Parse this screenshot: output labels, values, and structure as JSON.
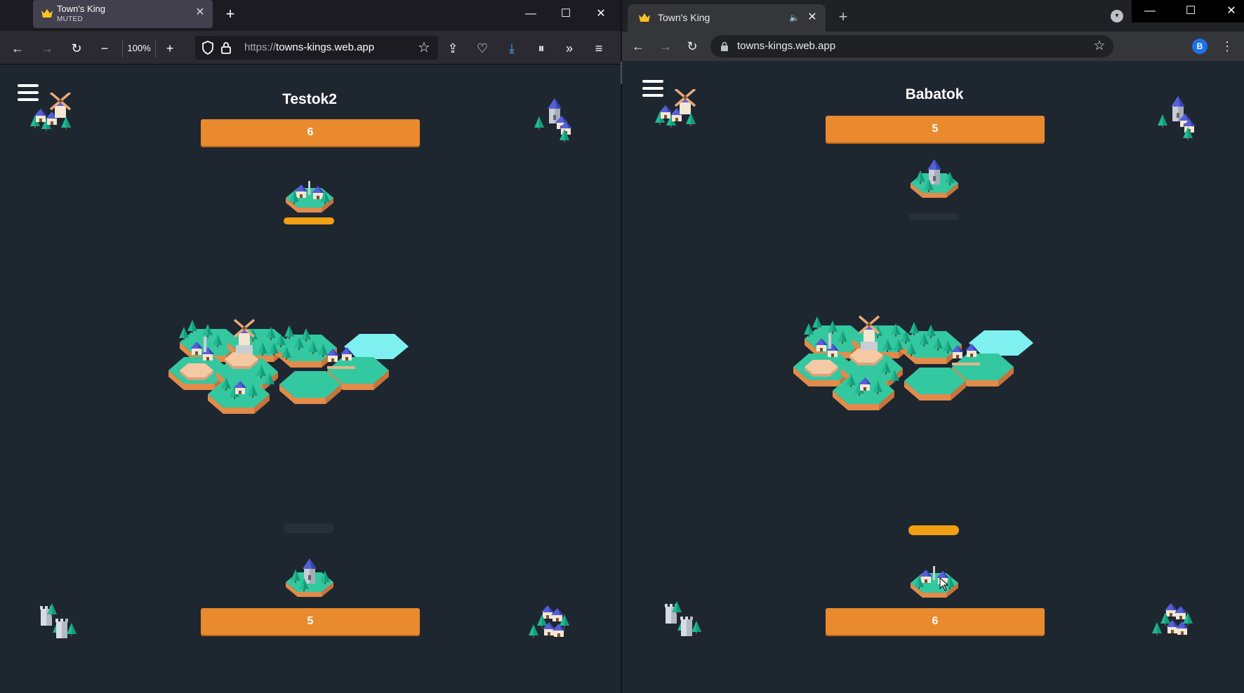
{
  "colors": {
    "game_bg": "#1e2630",
    "score_bar": "#ea8a2e",
    "turn_active": "#f0a012",
    "turn_inactive": "#27303a",
    "hex_grass": "#34c8a0",
    "hex_ice": "#7ff0f0",
    "roof_blue": "#5560d8",
    "tree_green": "#22b893"
  },
  "left_window": {
    "browser": "Firefox",
    "tab": {
      "title": "Town's King",
      "status": "MUTED",
      "icon": "crown-icon"
    },
    "zoom": "100%",
    "url_protocol": "https://",
    "url_host": "towns-kings.web.app",
    "game": {
      "top_player": {
        "name": "Testok2",
        "score": "6",
        "turn_active": true
      },
      "bottom_player": {
        "score": "5",
        "turn_active": false
      }
    }
  },
  "right_window": {
    "browser": "Chrome",
    "tab": {
      "title": "Town's King",
      "icon": "crown-icon"
    },
    "url": "towns-kings.web.app",
    "profile_initial": "B",
    "game": {
      "top_player": {
        "name": "Babatok",
        "score": "5",
        "turn_active": false
      },
      "bottom_player": {
        "score": "6",
        "turn_active": true
      }
    }
  }
}
